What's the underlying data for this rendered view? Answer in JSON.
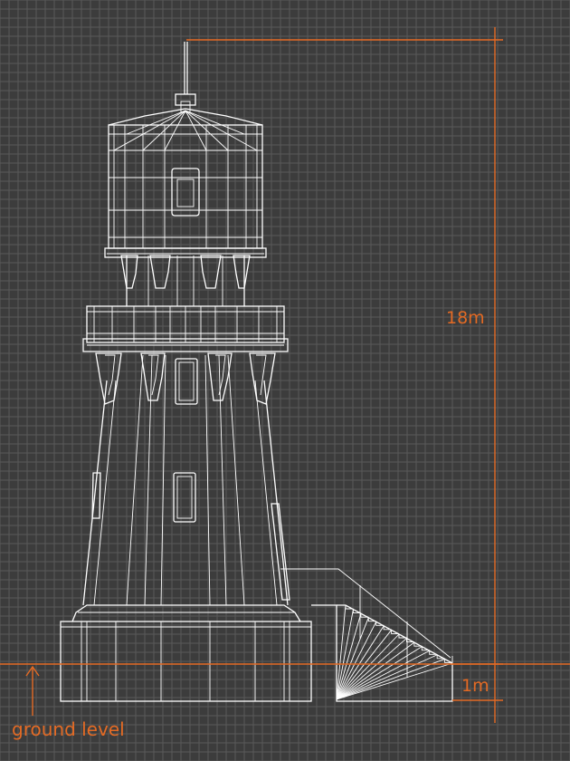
{
  "labels": {
    "height": "18m",
    "step": "1m",
    "ground": "ground level"
  },
  "colors": {
    "background": "#3c3c3c",
    "grid": "#5a5a5a",
    "linework": "#ffffff",
    "dimension": "#e36a24"
  }
}
